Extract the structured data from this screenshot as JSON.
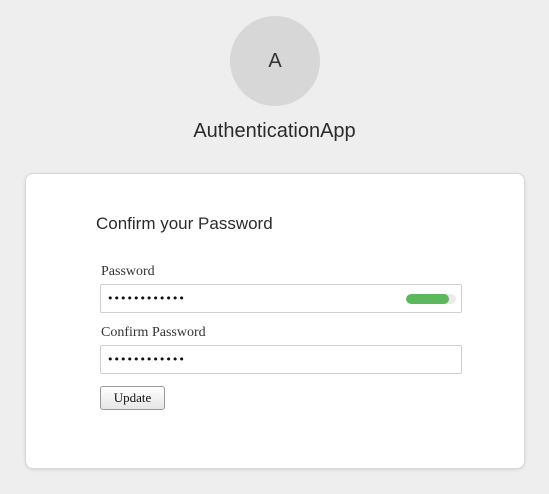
{
  "header": {
    "avatar_initial": "A",
    "app_name": "AuthenticationApp"
  },
  "form": {
    "title": "Confirm your Password",
    "password": {
      "label": "Password",
      "value": "••••••••••••",
      "strength_fraction": 0.85,
      "strength_color": "#5cb85c"
    },
    "confirm_password": {
      "label": "Confirm Password",
      "value": "••••••••••••"
    },
    "submit_label": "Update"
  }
}
